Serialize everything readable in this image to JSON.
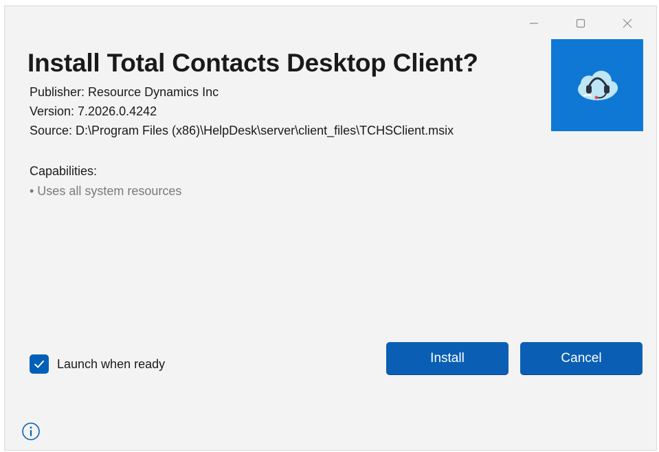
{
  "window": {
    "controls": {
      "minimize": "minimize-icon",
      "maximize": "maximize-icon",
      "close": "close-icon"
    }
  },
  "header": {
    "title": "Install Total Contacts Desktop Client?"
  },
  "details": {
    "publisher": "Publisher: Resource Dynamics Inc",
    "version": "Version: 7.2026.0.4242",
    "source": "Source: D:\\Program Files (x86)\\HelpDesk\\server\\client_files\\TCHSClient.msix"
  },
  "capabilities": {
    "title": "Capabilities:",
    "items": [
      "• Uses all system resources"
    ]
  },
  "app_tile": {
    "icon": "headset-cloud-icon",
    "background": "#0f78d4"
  },
  "options": {
    "launch_label": "Launch when ready",
    "launch_checked": true
  },
  "actions": {
    "install_label": "Install",
    "cancel_label": "Cancel",
    "button_color": "#0a5fb4"
  },
  "footer": {
    "info_icon": "info-icon"
  }
}
